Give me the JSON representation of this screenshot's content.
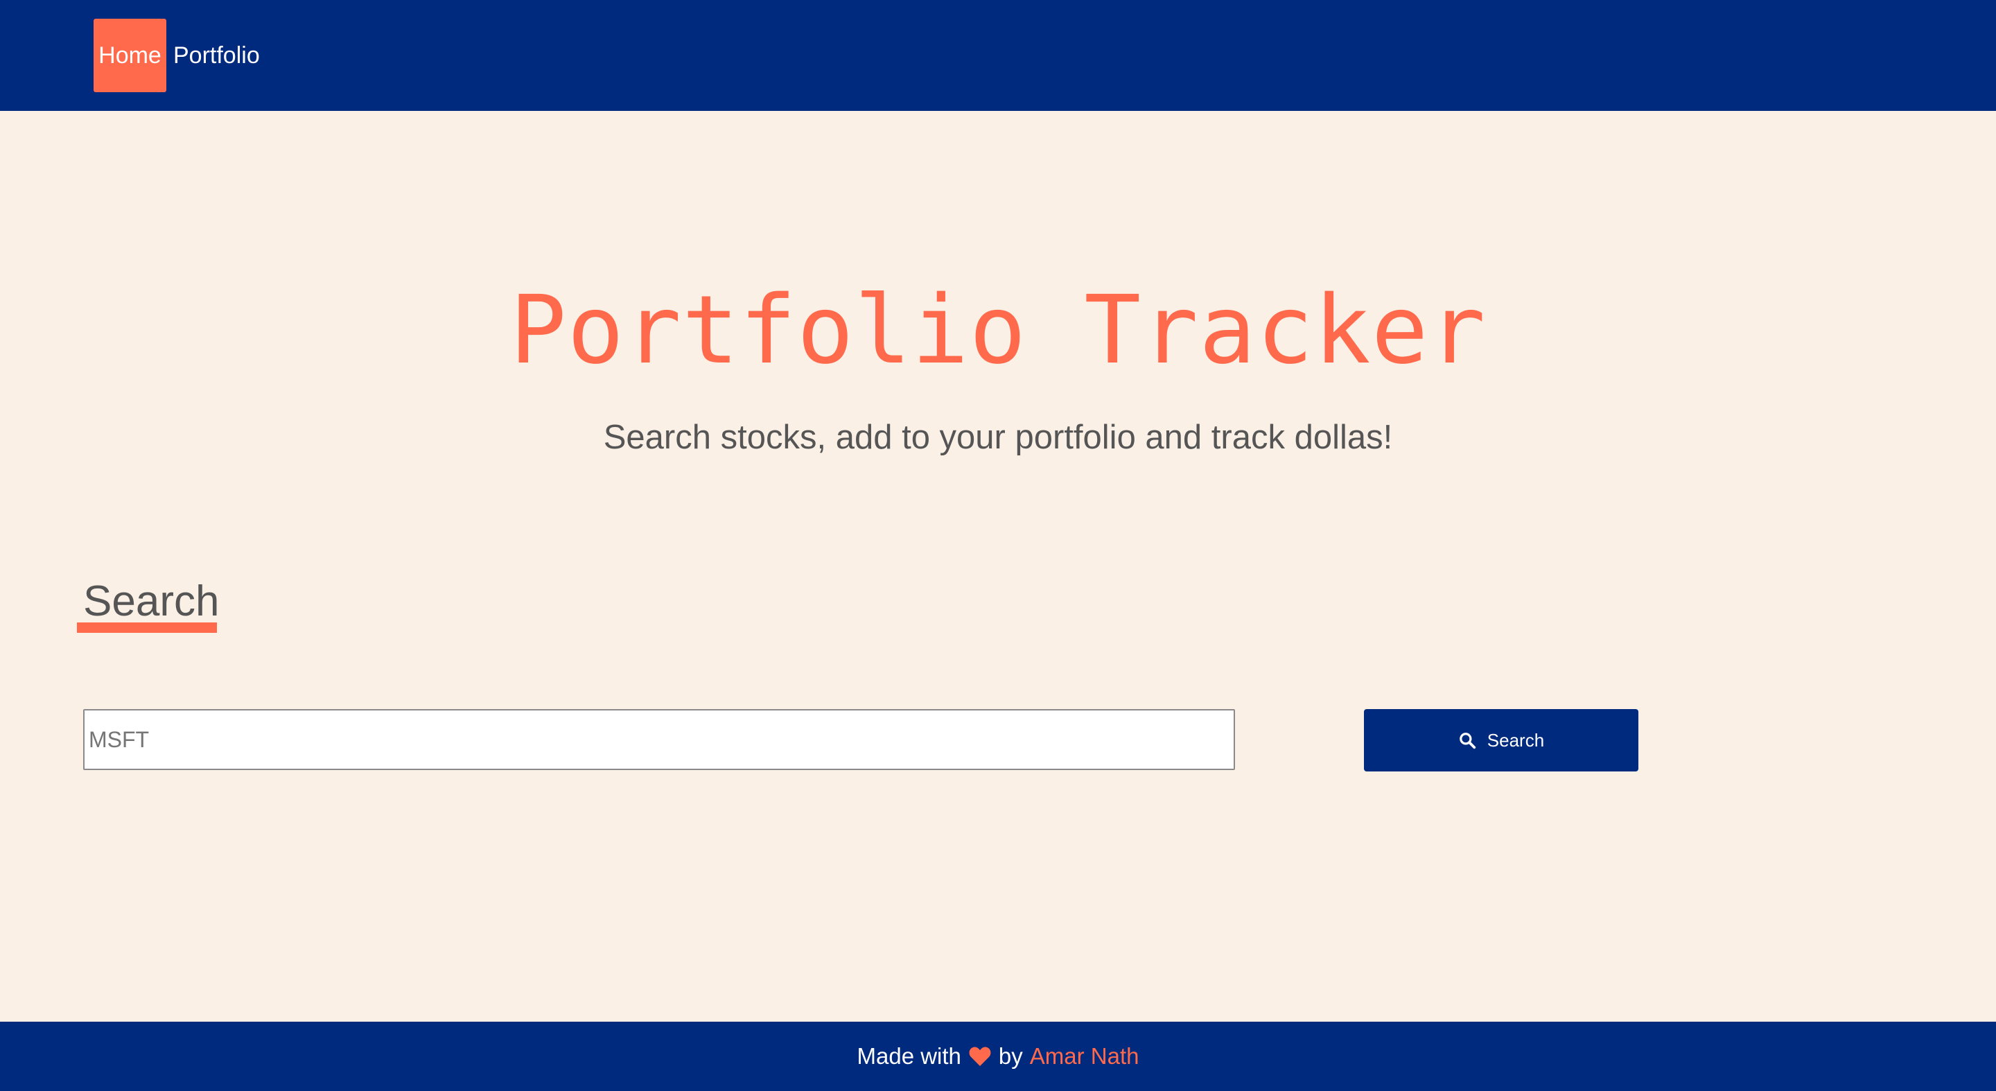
{
  "navbar": {
    "items": [
      {
        "label": "Home",
        "active": true
      },
      {
        "label": "Portfolio",
        "active": false
      }
    ]
  },
  "hero": {
    "title": "Portfolio Tracker",
    "subtitle": "Search stocks, add to your portfolio and track dollas!"
  },
  "search": {
    "heading": "Search",
    "input_placeholder": "MSFT",
    "input_value": "",
    "button_label": "Search",
    "button_icon": "search-icon"
  },
  "footer": {
    "made_with": "Made with",
    "heart_icon": "heart-icon",
    "by": "by",
    "author": "Amar Nath"
  },
  "colors": {
    "navy": "#002a7d",
    "accent": "#ff6a4c",
    "background": "#fbf0e6",
    "text_gray": "#555555"
  }
}
